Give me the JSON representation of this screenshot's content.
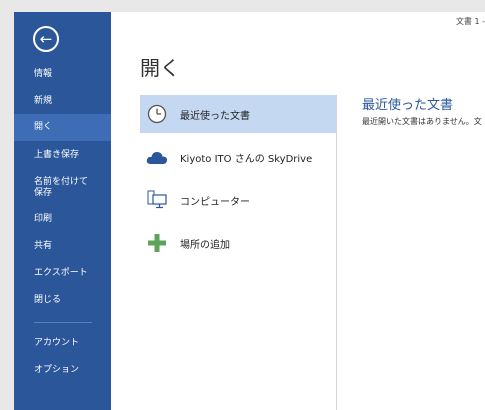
{
  "window": {
    "title": "文書 1 -"
  },
  "sidebar": {
    "back_icon": "back-arrow-icon",
    "items": [
      {
        "label": "情報"
      },
      {
        "label": "新規"
      },
      {
        "label": "開く"
      },
      {
        "label": "上書き保存"
      },
      {
        "label": "名前を付けて\n保存"
      },
      {
        "label": "印刷"
      },
      {
        "label": "共有"
      },
      {
        "label": "エクスポート"
      },
      {
        "label": "閉じる"
      },
      {
        "label": "アカウント"
      },
      {
        "label": "オプション"
      }
    ],
    "active_index": 2
  },
  "main": {
    "title": "開く",
    "places": [
      {
        "label": "最近使った文書",
        "icon": "clock-icon"
      },
      {
        "label": "Kiyoto ITO さんの SkyDrive",
        "icon": "cloud-icon"
      },
      {
        "label": "コンピューター",
        "icon": "computer-icon"
      },
      {
        "label": "場所の追加",
        "icon": "plus-icon"
      }
    ]
  },
  "recent": {
    "heading": "最近使った文書",
    "empty_message": "最近開いた文書はありません。文"
  },
  "colors": {
    "sidebar": "#2b579a",
    "sidebar_active": "#3e6db5",
    "selected_place": "#c5d8f2",
    "accent_text": "#2b579a"
  }
}
